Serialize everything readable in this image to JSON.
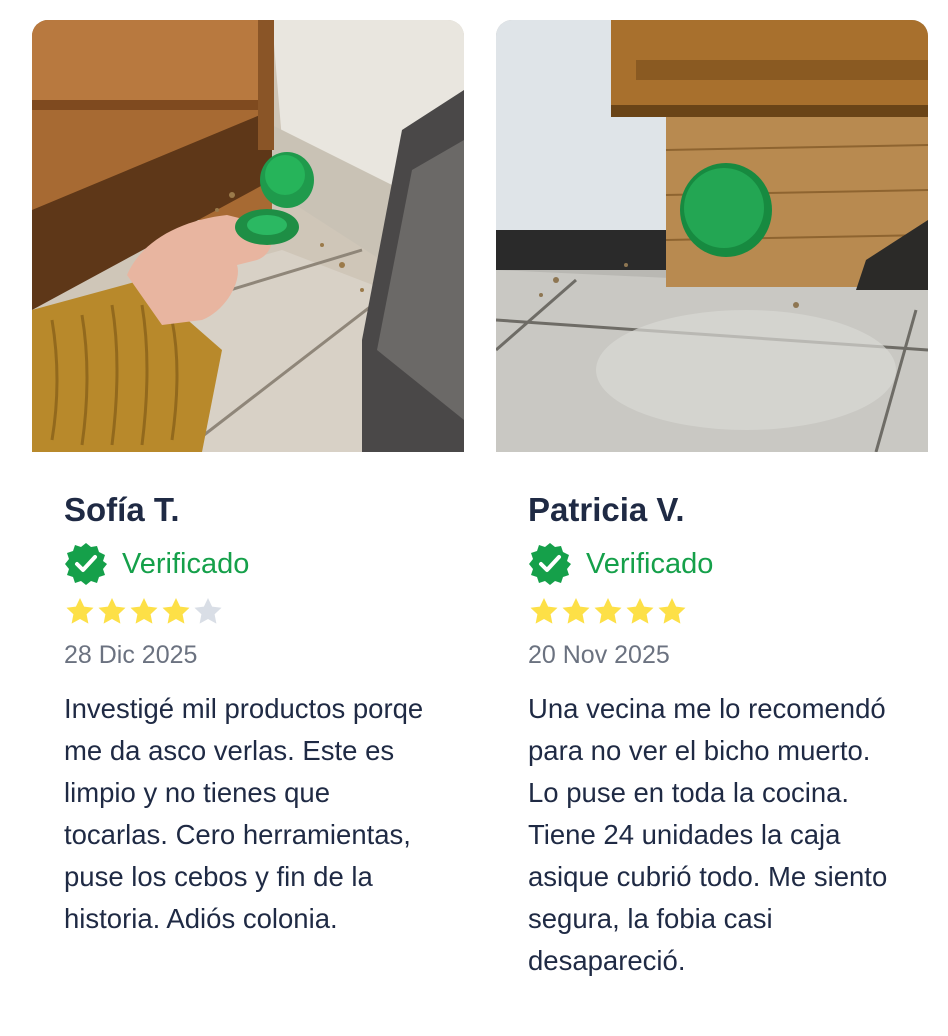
{
  "reviews": [
    {
      "name": "Sofía T.",
      "verified_label": "Verificado",
      "rating": 4,
      "max_rating": 5,
      "date": "28 Dic 2025",
      "text": "Investigé mil productos porqe me da asco verlas. Este es limpio y no tienes que tocarlas. Cero herramientas, puse los cebos y fin de la historia. Adiós colonia."
    },
    {
      "name": "Patricia V.",
      "verified_label": "Verificado",
      "rating": 5,
      "max_rating": 5,
      "date": "20 Nov 2025",
      "text": "Una vecina me lo recomendó para no ver el bicho muerto. Lo puse en toda la cocina. Tiene 24 unidades la caja asique cubrió todo. Me siento segura, la fobia casi desapareció."
    }
  ],
  "colors": {
    "name": "#1f2a44",
    "verified": "#15a04a",
    "star_filled": "#fde047",
    "star_empty": "#d9dee6",
    "date": "#6b7280",
    "body_text": "#1f2a44"
  },
  "icons": {
    "verified": "verified-badge-icon",
    "star": "star-icon"
  }
}
